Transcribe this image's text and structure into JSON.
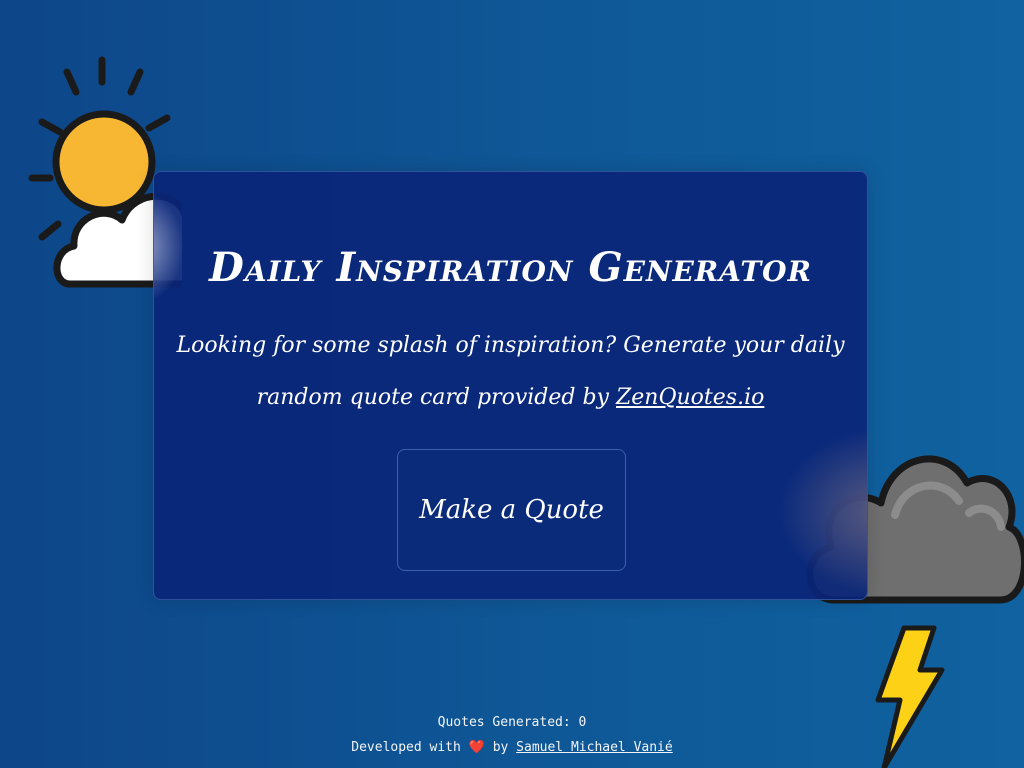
{
  "card": {
    "title": "Daily Inspiration Generator",
    "subtitle_text": "Looking for some splash of inspiration? Generate your daily random quote card provided by",
    "subtitle_link": "ZenQuotes.io",
    "button_label": "Make a Quote"
  },
  "footer": {
    "counter_label": "Quotes Generated:",
    "counter_value": "0",
    "credit_prefix": "Developed with",
    "heart": "❤️",
    "credit_by": "by",
    "author_link": "Samuel Michael Vanié"
  },
  "icons": [
    "sun-cloud-icon",
    "storm-cloud-icon",
    "lightning-bolt-icon",
    "heart-icon"
  ],
  "colors": {
    "background": "#0f5897",
    "card": "#0a2678",
    "sun": "#f7b733",
    "storm_cloud": "#6f6f6f",
    "bolt": "#fcd116",
    "heart": "#e8424f"
  }
}
